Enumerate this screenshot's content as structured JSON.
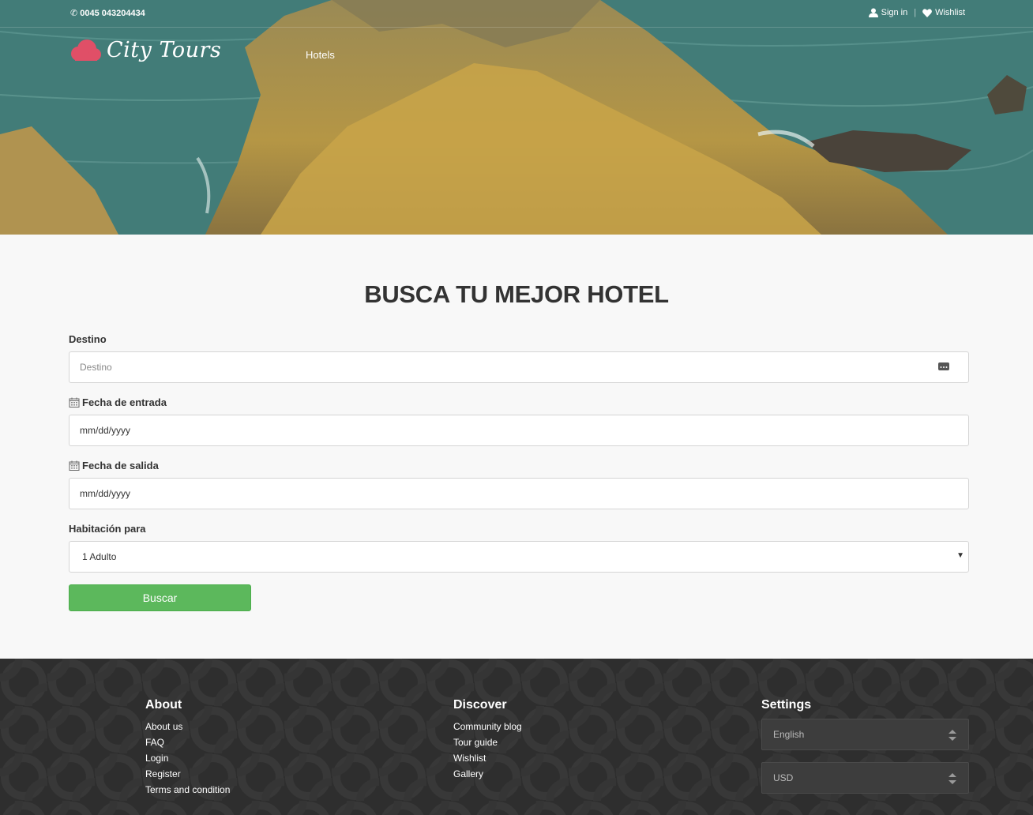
{
  "header": {
    "phone": "0045 043204434",
    "sign_in": "Sign in",
    "wishlist": "Wishlist",
    "brand": "City Tours",
    "nav_hotels": "Hotels"
  },
  "search": {
    "title": "BUSCA TU MEJOR HOTEL",
    "destination": {
      "label": "Destino",
      "placeholder": "Destino"
    },
    "checkin": {
      "label": "Fecha de entrada",
      "value": "mm/dd/yyyy"
    },
    "checkout": {
      "label": "Fecha de salida",
      "value": "mm/dd/yyyy"
    },
    "room": {
      "label": "Habitación para",
      "selected": "1 Adulto"
    },
    "submit": "Buscar"
  },
  "footer": {
    "about": {
      "heading": "About",
      "links": [
        "About us",
        "FAQ",
        "Login",
        "Register",
        "Terms and condition"
      ]
    },
    "discover": {
      "heading": "Discover",
      "links": [
        "Community blog",
        "Tour guide",
        "Wishlist",
        "Gallery"
      ]
    },
    "settings": {
      "heading": "Settings",
      "language": "English",
      "currency": "USD"
    }
  },
  "colors": {
    "brand_pink": "#e04f67",
    "button_green": "#5cb85c",
    "footer_bg": "#2e2e2e"
  },
  "icons": {
    "phone": "phone-icon",
    "user": "user-icon",
    "heart": "heart-icon",
    "calendar": "calendar-icon",
    "more": "more-icon",
    "caret": "caret-down-icon",
    "sort": "sort-arrows-icon"
  }
}
